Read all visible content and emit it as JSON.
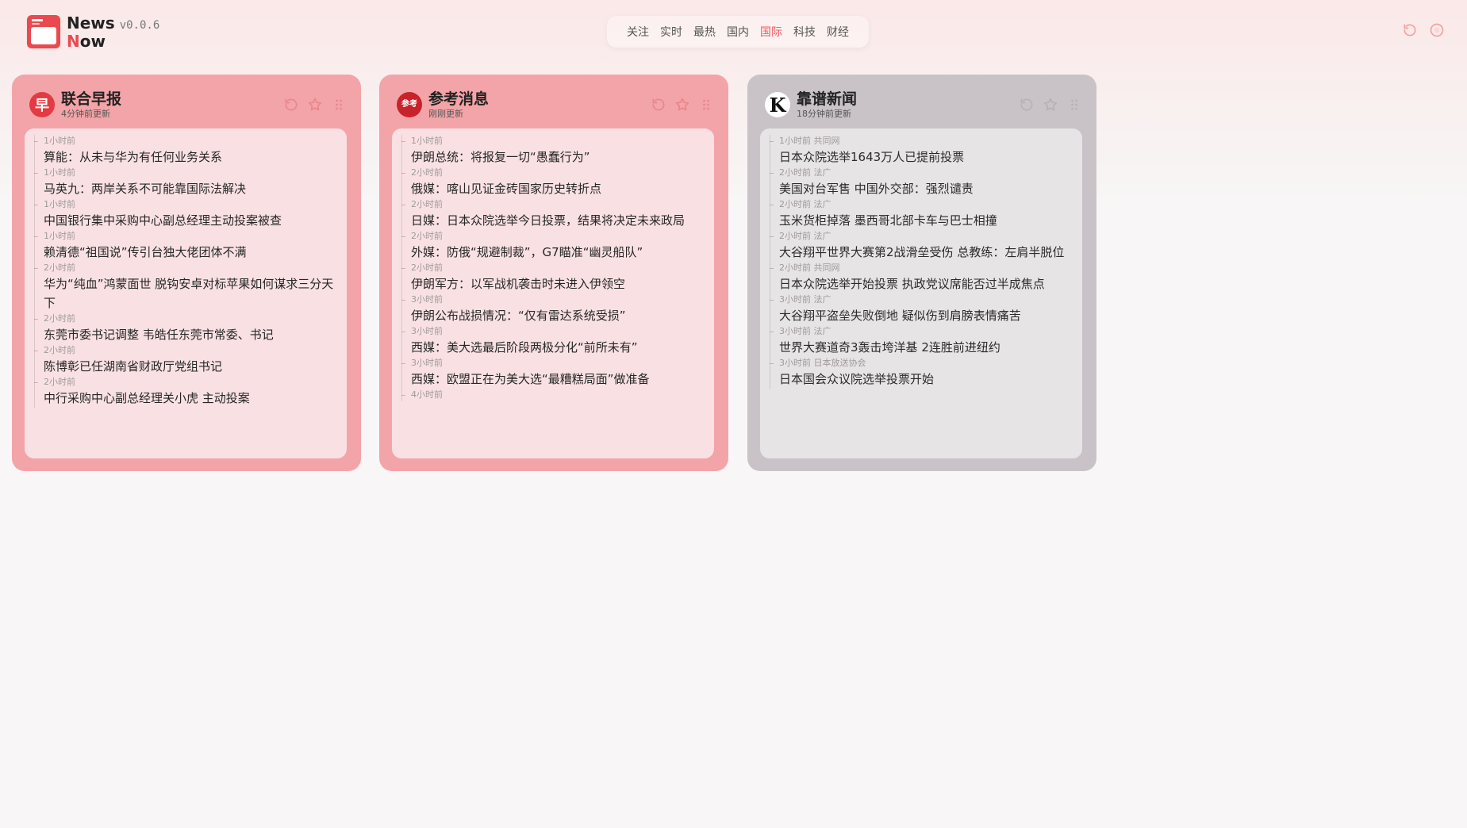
{
  "app": {
    "name_line1": "News",
    "name_line2_first": "N",
    "name_line2_rest": "ow",
    "version": "v0.0.6"
  },
  "nav": {
    "items": [
      "关注",
      "实时",
      "最热",
      "国内",
      "国际",
      "科技",
      "财经"
    ],
    "active": "国际"
  },
  "colors": {
    "accent": "#ee5a60",
    "card_red": "#f3a4a8",
    "card_gray": "#c9c3c7"
  },
  "cards": [
    {
      "title": "联合早报",
      "updated": "4分钟前更新",
      "icon_glyph": "早",
      "items": [
        {
          "meta": "1小时前",
          "title": "算能：从未与华为有任何业务关系"
        },
        {
          "meta": "1小时前",
          "title": "马英九：两岸关系不可能靠国际法解决"
        },
        {
          "meta": "1小时前",
          "title": "中国银行集中采购中心副总经理主动投案被查"
        },
        {
          "meta": "1小时前",
          "title": "赖清德“祖国说”传引台独大佬团体不满"
        },
        {
          "meta": "2小时前",
          "title": "华为“纯血”鸿蒙面世 脱钩安卓对标苹果如何谋求三分天下"
        },
        {
          "meta": "2小时前",
          "title": "东莞市委书记调整 韦皓任东莞市常委、书记"
        },
        {
          "meta": "2小时前",
          "title": "陈博彰已任湖南省财政厅党组书记"
        },
        {
          "meta": "2小时前",
          "title": "中行采购中心副总经理关小虎 主动投案"
        }
      ]
    },
    {
      "title": "参考消息",
      "updated": "刚刚更新",
      "icon_glyph": "参考",
      "items": [
        {
          "meta": "1小时前",
          "title": "伊朗总统：将报复一切“愚蠢行为”"
        },
        {
          "meta": "2小时前",
          "title": "俄媒：喀山见证金砖国家历史转折点"
        },
        {
          "meta": "2小时前",
          "title": "日媒：日本众院选举今日投票，结果将决定未来政局"
        },
        {
          "meta": "2小时前",
          "title": "外媒：防俄“规避制裁”，G7瞄准“幽灵船队”"
        },
        {
          "meta": "2小时前",
          "title": "伊朗军方：以军战机袭击时未进入伊领空"
        },
        {
          "meta": "3小时前",
          "title": "伊朗公布战损情况：“仅有雷达系统受损”"
        },
        {
          "meta": "3小时前",
          "title": "西媒：美大选最后阶段两极分化“前所未有”"
        },
        {
          "meta": "3小时前",
          "title": "西媒：欧盟正在为美大选“最糟糕局面”做准备"
        },
        {
          "meta": "4小时前",
          "title": ""
        }
      ]
    },
    {
      "title": "靠谱新闻",
      "updated": "18分钟前更新",
      "icon_glyph": "K",
      "items": [
        {
          "meta": "1小时前 共同网",
          "title": "日本众院选举1643万人已提前投票"
        },
        {
          "meta": "2小时前 法广",
          "title": "美国对台军售 中国外交部：强烈谴责"
        },
        {
          "meta": "2小时前 法广",
          "title": "玉米货柜掉落 墨西哥北部卡车与巴士相撞"
        },
        {
          "meta": "2小时前 法广",
          "title": "大谷翔平世界大赛第2战滑垒受伤 总教练：左肩半脱位"
        },
        {
          "meta": "2小时前 共同网",
          "title": "日本众院选举开始投票 执政党议席能否过半成焦点"
        },
        {
          "meta": "3小时前 法广",
          "title": "大谷翔平盗垒失败倒地 疑似伤到肩膀表情痛苦"
        },
        {
          "meta": "3小时前 法广",
          "title": "世界大赛道奇3轰击垮洋基 2连胜前进纽约"
        },
        {
          "meta": "3小时前 日本放送协会",
          "title": "日本国会众议院选举投票开始"
        }
      ]
    }
  ]
}
